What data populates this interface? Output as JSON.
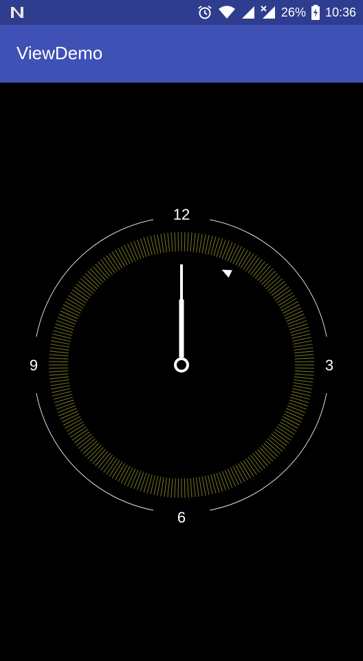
{
  "status_bar": {
    "battery_percent": "26%",
    "time": "10:36",
    "icons": [
      "n-notification-icon",
      "alarm-icon",
      "wifi-icon",
      "signal-icon",
      "no-signal-icon",
      "battery-charging-icon"
    ]
  },
  "app_bar": {
    "title": "ViewDemo"
  },
  "clock": {
    "numerals": {
      "twelve": "12",
      "three": "3",
      "six": "6",
      "nine": "9"
    },
    "hour_hand_angle_deg": 0,
    "minute_hand_angle_deg": 0,
    "marker_angle_deg": 26,
    "colors": {
      "ring": "#dddddd",
      "ticks": "#7a7a28",
      "hands": "#ffffff"
    }
  }
}
